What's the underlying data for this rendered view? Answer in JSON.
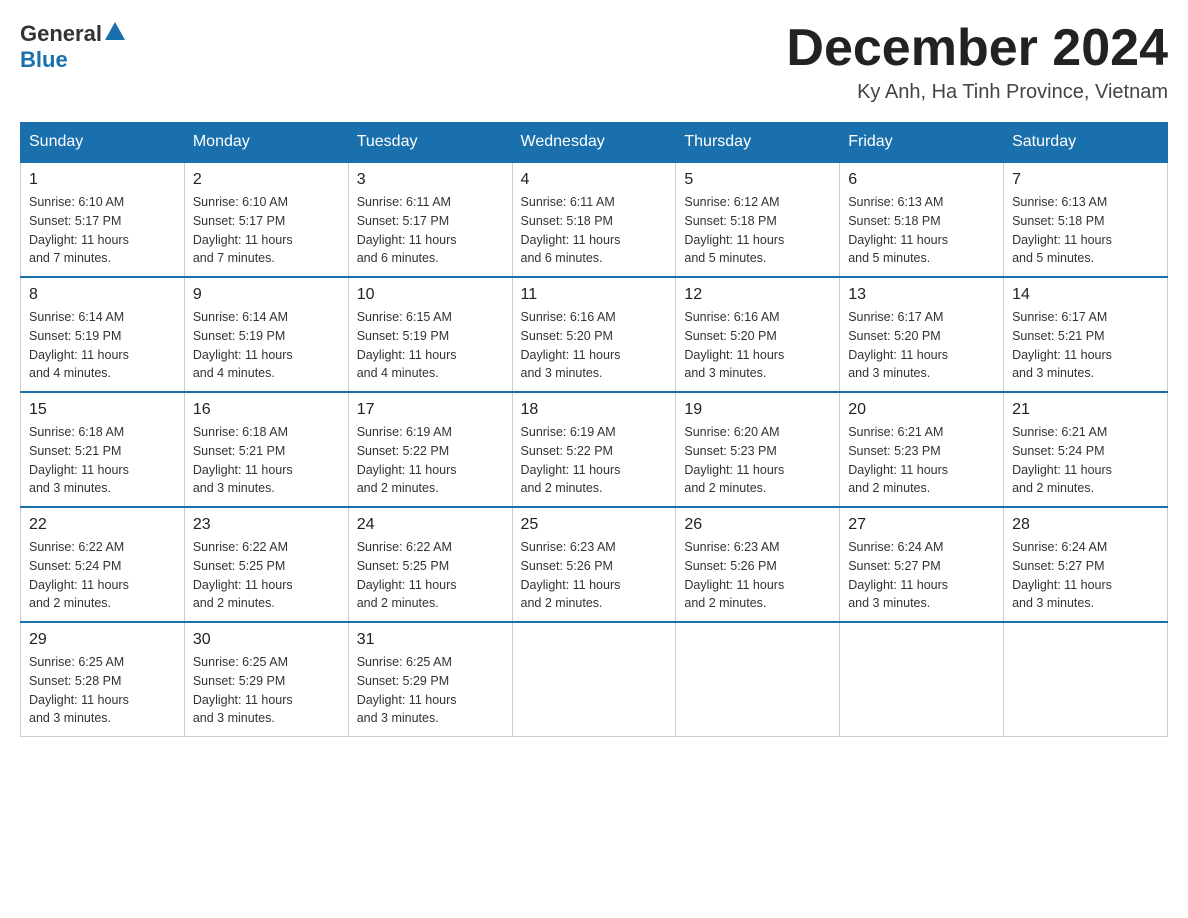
{
  "header": {
    "logo_general": "General",
    "logo_blue": "Blue",
    "month_title": "December 2024",
    "location": "Ky Anh, Ha Tinh Province, Vietnam"
  },
  "days_of_week": [
    "Sunday",
    "Monday",
    "Tuesday",
    "Wednesday",
    "Thursday",
    "Friday",
    "Saturday"
  ],
  "weeks": [
    [
      {
        "day": "1",
        "sunrise": "6:10 AM",
        "sunset": "5:17 PM",
        "daylight": "11 hours and 7 minutes."
      },
      {
        "day": "2",
        "sunrise": "6:10 AM",
        "sunset": "5:17 PM",
        "daylight": "11 hours and 7 minutes."
      },
      {
        "day": "3",
        "sunrise": "6:11 AM",
        "sunset": "5:17 PM",
        "daylight": "11 hours and 6 minutes."
      },
      {
        "day": "4",
        "sunrise": "6:11 AM",
        "sunset": "5:18 PM",
        "daylight": "11 hours and 6 minutes."
      },
      {
        "day": "5",
        "sunrise": "6:12 AM",
        "sunset": "5:18 PM",
        "daylight": "11 hours and 5 minutes."
      },
      {
        "day": "6",
        "sunrise": "6:13 AM",
        "sunset": "5:18 PM",
        "daylight": "11 hours and 5 minutes."
      },
      {
        "day": "7",
        "sunrise": "6:13 AM",
        "sunset": "5:18 PM",
        "daylight": "11 hours and 5 minutes."
      }
    ],
    [
      {
        "day": "8",
        "sunrise": "6:14 AM",
        "sunset": "5:19 PM",
        "daylight": "11 hours and 4 minutes."
      },
      {
        "day": "9",
        "sunrise": "6:14 AM",
        "sunset": "5:19 PM",
        "daylight": "11 hours and 4 minutes."
      },
      {
        "day": "10",
        "sunrise": "6:15 AM",
        "sunset": "5:19 PM",
        "daylight": "11 hours and 4 minutes."
      },
      {
        "day": "11",
        "sunrise": "6:16 AM",
        "sunset": "5:20 PM",
        "daylight": "11 hours and 3 minutes."
      },
      {
        "day": "12",
        "sunrise": "6:16 AM",
        "sunset": "5:20 PM",
        "daylight": "11 hours and 3 minutes."
      },
      {
        "day": "13",
        "sunrise": "6:17 AM",
        "sunset": "5:20 PM",
        "daylight": "11 hours and 3 minutes."
      },
      {
        "day": "14",
        "sunrise": "6:17 AM",
        "sunset": "5:21 PM",
        "daylight": "11 hours and 3 minutes."
      }
    ],
    [
      {
        "day": "15",
        "sunrise": "6:18 AM",
        "sunset": "5:21 PM",
        "daylight": "11 hours and 3 minutes."
      },
      {
        "day": "16",
        "sunrise": "6:18 AM",
        "sunset": "5:21 PM",
        "daylight": "11 hours and 3 minutes."
      },
      {
        "day": "17",
        "sunrise": "6:19 AM",
        "sunset": "5:22 PM",
        "daylight": "11 hours and 2 minutes."
      },
      {
        "day": "18",
        "sunrise": "6:19 AM",
        "sunset": "5:22 PM",
        "daylight": "11 hours and 2 minutes."
      },
      {
        "day": "19",
        "sunrise": "6:20 AM",
        "sunset": "5:23 PM",
        "daylight": "11 hours and 2 minutes."
      },
      {
        "day": "20",
        "sunrise": "6:21 AM",
        "sunset": "5:23 PM",
        "daylight": "11 hours and 2 minutes."
      },
      {
        "day": "21",
        "sunrise": "6:21 AM",
        "sunset": "5:24 PM",
        "daylight": "11 hours and 2 minutes."
      }
    ],
    [
      {
        "day": "22",
        "sunrise": "6:22 AM",
        "sunset": "5:24 PM",
        "daylight": "11 hours and 2 minutes."
      },
      {
        "day": "23",
        "sunrise": "6:22 AM",
        "sunset": "5:25 PM",
        "daylight": "11 hours and 2 minutes."
      },
      {
        "day": "24",
        "sunrise": "6:22 AM",
        "sunset": "5:25 PM",
        "daylight": "11 hours and 2 minutes."
      },
      {
        "day": "25",
        "sunrise": "6:23 AM",
        "sunset": "5:26 PM",
        "daylight": "11 hours and 2 minutes."
      },
      {
        "day": "26",
        "sunrise": "6:23 AM",
        "sunset": "5:26 PM",
        "daylight": "11 hours and 2 minutes."
      },
      {
        "day": "27",
        "sunrise": "6:24 AM",
        "sunset": "5:27 PM",
        "daylight": "11 hours and 3 minutes."
      },
      {
        "day": "28",
        "sunrise": "6:24 AM",
        "sunset": "5:27 PM",
        "daylight": "11 hours and 3 minutes."
      }
    ],
    [
      {
        "day": "29",
        "sunrise": "6:25 AM",
        "sunset": "5:28 PM",
        "daylight": "11 hours and 3 minutes."
      },
      {
        "day": "30",
        "sunrise": "6:25 AM",
        "sunset": "5:29 PM",
        "daylight": "11 hours and 3 minutes."
      },
      {
        "day": "31",
        "sunrise": "6:25 AM",
        "sunset": "5:29 PM",
        "daylight": "11 hours and 3 minutes."
      },
      null,
      null,
      null,
      null
    ]
  ],
  "labels": {
    "sunrise": "Sunrise:",
    "sunset": "Sunset:",
    "daylight": "Daylight:"
  }
}
